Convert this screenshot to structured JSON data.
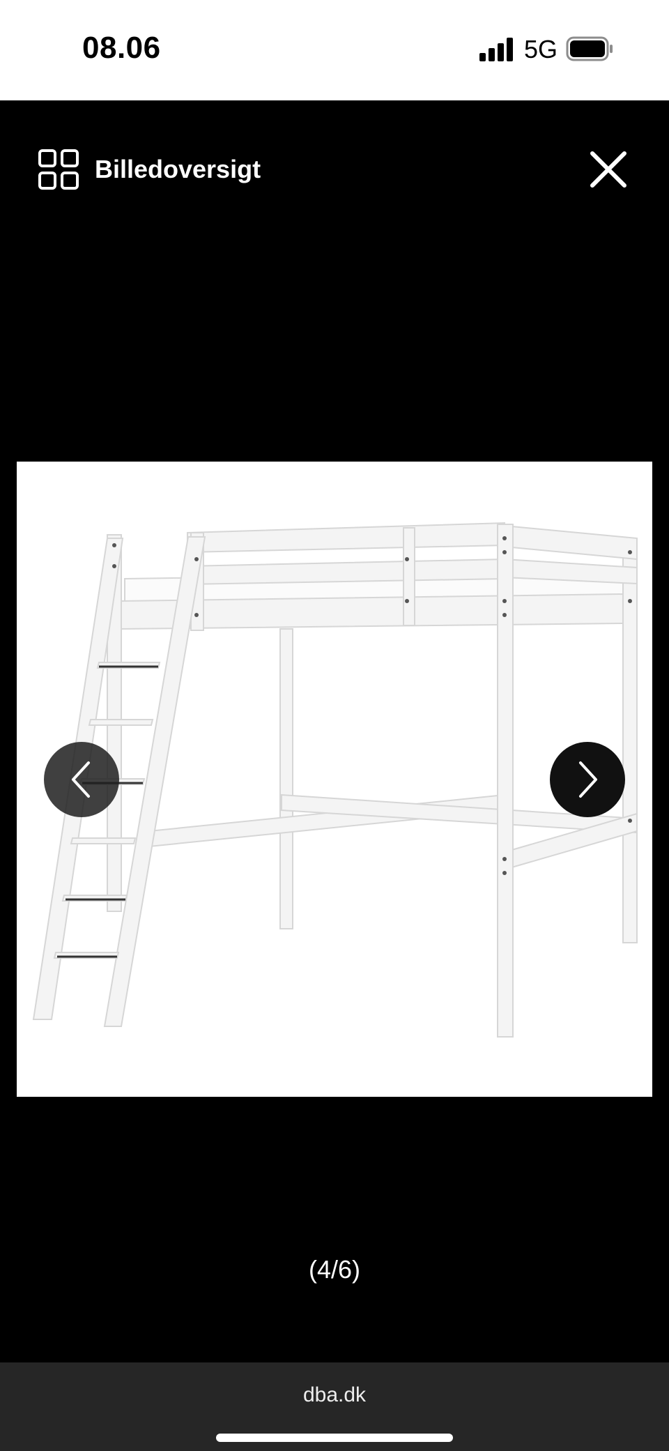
{
  "status_bar": {
    "time": "08.06",
    "network": "5G",
    "icons": [
      "signal-icon",
      "battery-icon"
    ]
  },
  "viewer": {
    "overview_label": "Billedoversigt",
    "icons": [
      "grid-icon",
      "close-icon",
      "chevron-left-icon",
      "chevron-right-icon"
    ],
    "counter": "(4/6)",
    "current_index": 4,
    "total_images": 6
  },
  "browser": {
    "url": "dba.dk"
  },
  "colors": {
    "background": "#000000",
    "status_bar_bg": "#ffffff",
    "browser_bar_bg": "#262626",
    "text_light": "#ffffff"
  }
}
